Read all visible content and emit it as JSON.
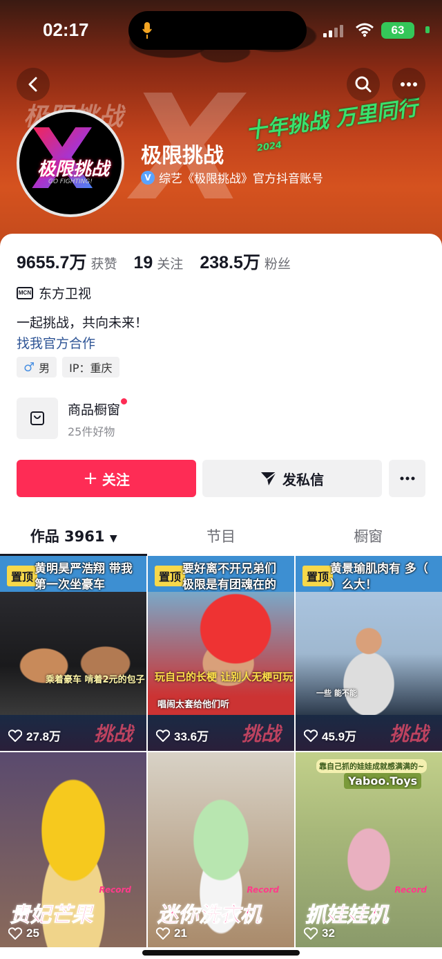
{
  "status_bar": {
    "time": "02:17",
    "battery": "63"
  },
  "profile": {
    "name": "极限挑战",
    "verified_text": "综艺《极限挑战》官方抖音账号",
    "avatar_title": "极限挑战",
    "avatar_sub": "GO FIGHTING!",
    "banner_slogan": "十年挑战 万里同行",
    "banner_year": "2024",
    "banner_x": "X",
    "banner_ghost": "极限挑战"
  },
  "stats": [
    {
      "value": "9655.7万",
      "label": "获赞"
    },
    {
      "value": "19",
      "label": "关注"
    },
    {
      "value": "238.5万",
      "label": "粉丝"
    }
  ],
  "mcn": {
    "icon_text": "MCN",
    "label": "东方卫视"
  },
  "bio": "一起挑战，共向未来！",
  "coop_link": "找我官方合作",
  "tags": {
    "gender": "男",
    "ip": "IP：重庆"
  },
  "shop": {
    "title": "商品橱窗",
    "subtitle": "25件好物"
  },
  "buttons": {
    "follow": "关注",
    "message": "发私信"
  },
  "tabs": [
    {
      "label": "作品 3961"
    },
    {
      "label": "节目"
    },
    {
      "label": "橱窗"
    }
  ],
  "videos": [
    {
      "pin": "置顶",
      "caption": "黄明昊严浩翔 带我第一次坐豪车",
      "inner": "乘着豪车 啃着2元的包子",
      "likes": "27.8万",
      "watermark": "挑战"
    },
    {
      "pin": "置顶",
      "caption": "要好离不开兄弟们 极限是有团魂在的",
      "inner": "玩自己的长梗 让别人无梗可玩",
      "inner2": "唱闹太套给他们听",
      "likes": "33.6万",
      "watermark": "挑战"
    },
    {
      "pin": "置顶",
      "caption": "黄景瑜肌肉有 多（ ）么大！",
      "inner": "一些 能不能",
      "likes": "45.9万",
      "watermark": "挑战"
    },
    {
      "title": "贵妃芒果",
      "rec": "Record",
      "likes": "25"
    },
    {
      "title": "迷你洗衣机",
      "rec": "Record",
      "likes": "21"
    },
    {
      "title": "抓娃娃机",
      "rec": "Record",
      "likes": "32",
      "banner": "靠自己抓的娃娃成就感满满的~",
      "brand": "Yaboo.Toys"
    }
  ]
}
